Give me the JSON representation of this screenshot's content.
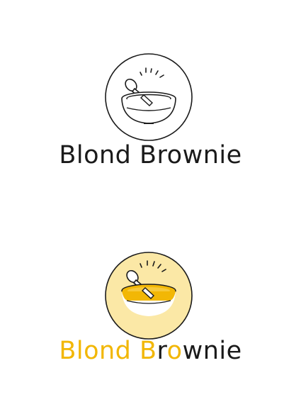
{
  "logos": {
    "outline": {
      "wordmark": "Blond Brownie",
      "icon": "mixing-bowl-with-spoon-icon",
      "colors": {
        "stroke": "#1a1a1a",
        "background": "#ffffff"
      }
    },
    "color": {
      "wordmark_part1": "Blond",
      "wordmark_space": " ",
      "wordmark_part2_initial": "B",
      "wordmark_part2_rest": "r",
      "wordmark_part2_o": "o",
      "wordmark_part2_end": "wnie",
      "icon": "mixing-bowl-with-spoon-icon",
      "colors": {
        "circle_fill": "#fbe8a6",
        "circle_stroke": "#1a1a1a",
        "batter": "#f2b705",
        "bowl_fill": "#ffffff",
        "text_accent": "#f2b705",
        "text_dark": "#1a1a1a"
      }
    }
  }
}
